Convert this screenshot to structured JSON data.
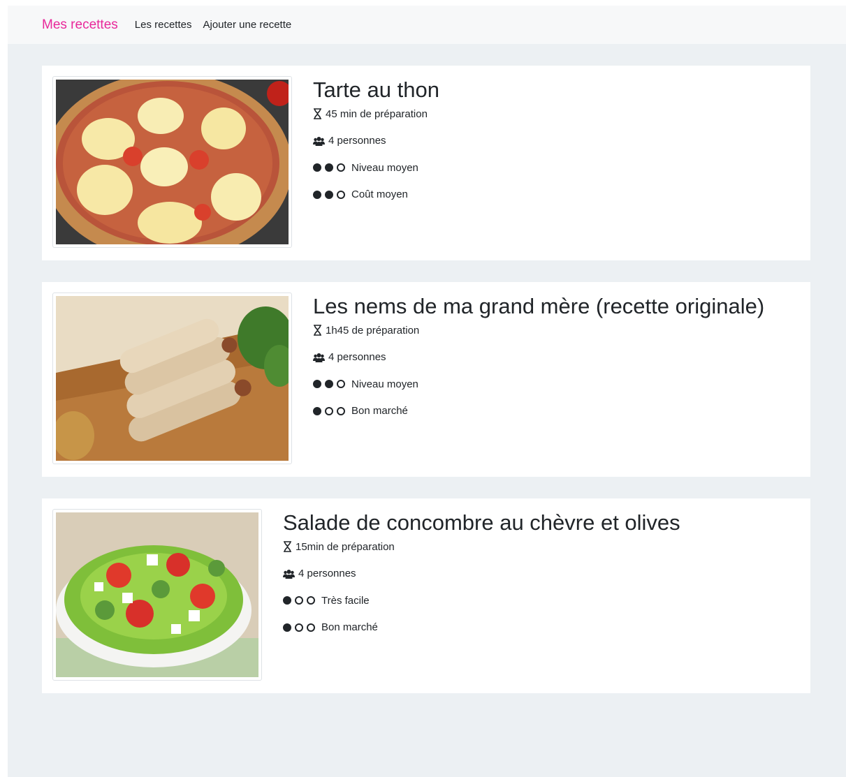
{
  "nav": {
    "brand": "Mes recettes",
    "links": [
      "Les recettes",
      "Ajouter une recette"
    ]
  },
  "colors": {
    "brand": "#e8289a",
    "page_bg": "#ecf0f3",
    "text": "#212529"
  },
  "icons": {
    "time": "hourglass-icon",
    "people": "users-icon"
  },
  "recipes": [
    {
      "title": "Tarte au thon",
      "time": "45 min de préparation",
      "people": "4 personnes",
      "level": "Niveau moyen",
      "level_score": 2,
      "cost": "Coût moyen",
      "cost_score": 2
    },
    {
      "title": "Les nems de ma grand mère (recette originale)",
      "time": "1h45 de préparation",
      "people": "4 personnes",
      "level": "Niveau moyen",
      "level_score": 2,
      "cost": "Bon marché",
      "cost_score": 1
    },
    {
      "title": "Salade de concombre au chèvre et olives",
      "time": "15min de préparation",
      "people": "4 personnes",
      "level": "Très facile",
      "level_score": 1,
      "cost": "Bon marché",
      "cost_score": 1
    }
  ]
}
